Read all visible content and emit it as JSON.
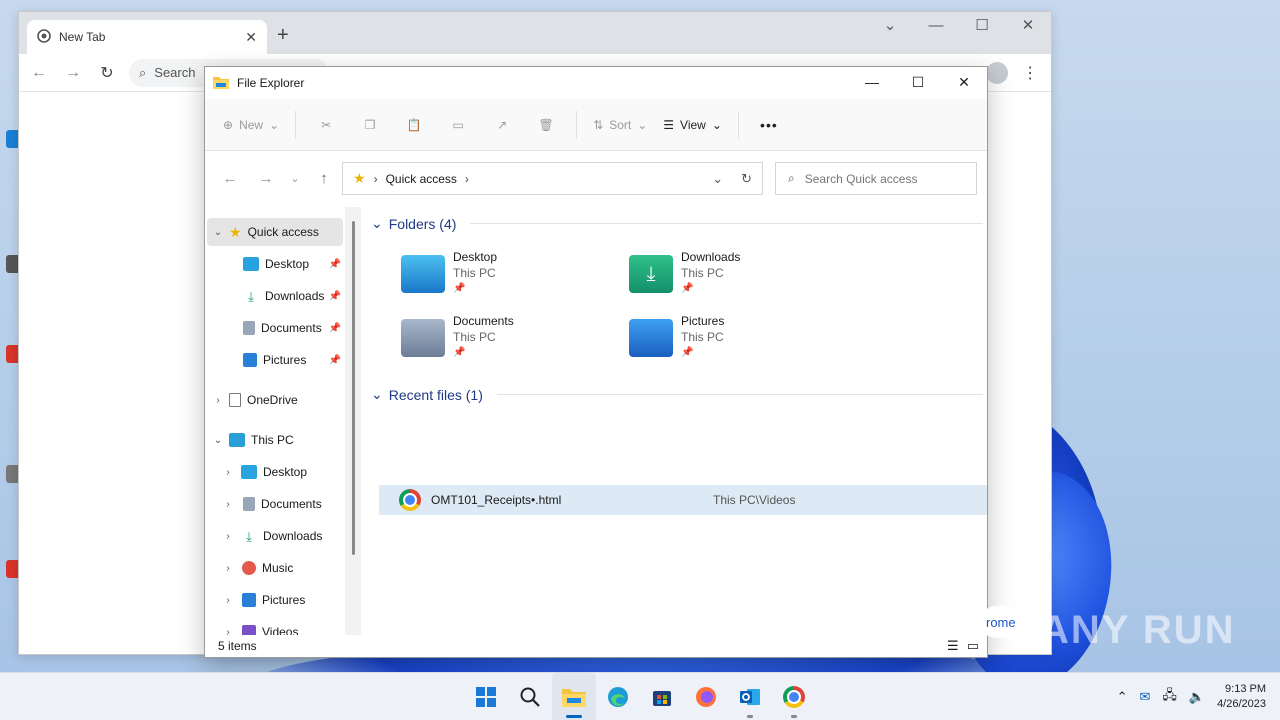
{
  "chrome": {
    "tab_title": "New Tab",
    "search_placeholder": "Search",
    "new_tab_symbol": "+",
    "notification_text": "rome"
  },
  "explorer": {
    "title": "File Explorer",
    "commands": {
      "new": "New",
      "sort": "Sort",
      "view": "View",
      "more": "•••"
    },
    "address": {
      "segment": "Quick access"
    },
    "search_placeholder": "Search Quick access",
    "nav": {
      "quick_access": "Quick access",
      "qa_desktop": "Desktop",
      "qa_downloads": "Downloads",
      "qa_documents": "Documents",
      "qa_pictures": "Pictures",
      "onedrive": "OneDrive",
      "this_pc": "This PC",
      "pc_desktop": "Desktop",
      "pc_documents": "Documents",
      "pc_downloads": "Downloads",
      "pc_music": "Music",
      "pc_pictures": "Pictures",
      "pc_videos": "Videos"
    },
    "folders_header": "Folders (4)",
    "folders": [
      {
        "name": "Desktop",
        "location": "This PC"
      },
      {
        "name": "Downloads",
        "location": "This PC"
      },
      {
        "name": "Documents",
        "location": "This PC"
      },
      {
        "name": "Pictures",
        "location": "This PC"
      }
    ],
    "recent_header": "Recent files (1)",
    "recent_files": [
      {
        "name": "OMT101_Receipts•.html",
        "path": "This PC\\Videos"
      }
    ],
    "status": "5 items"
  },
  "watermark": "ANY RUN",
  "taskbar": {
    "time": "9:13 PM",
    "date": "4/26/2023"
  },
  "colors": {
    "accent": "#0067c0",
    "selection": "#dde9f5",
    "group_header": "#1f3a88"
  }
}
